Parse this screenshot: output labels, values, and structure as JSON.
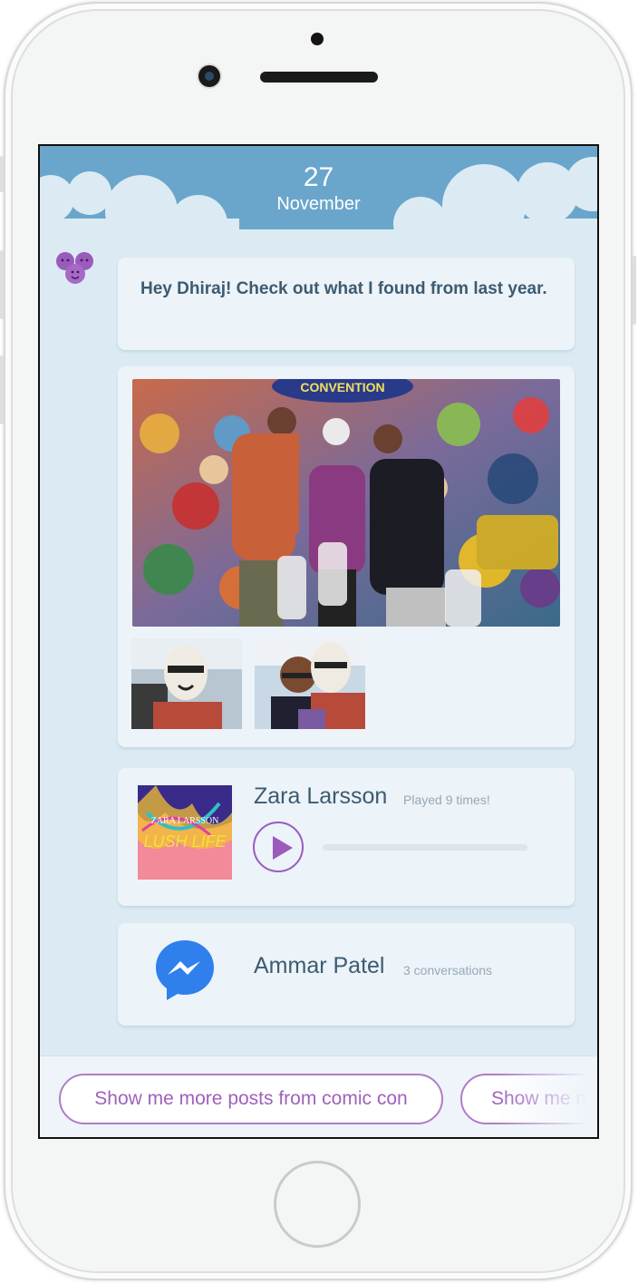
{
  "header": {
    "day": "27",
    "month": "November"
  },
  "colors": {
    "header_blue": "#6aa6cb",
    "background": "#dcebf3",
    "card": "#ecf3f9",
    "accent_purple": "#9a5bbd",
    "text_dark": "#3d5b70",
    "messenger_blue": "#2f80ed"
  },
  "bot": {
    "avatar_icon": "purple-faces-icon",
    "message": "Hey Dhiraj! Check out what I found from last year."
  },
  "photos": {
    "main_sign": "CONVENTION"
  },
  "music": {
    "album_title": "LUSH LIFE",
    "album_artist": "ZARA LARSSON",
    "artist": "Zara Larsson",
    "play_count": "Played 9 times!",
    "progress": 0
  },
  "chat": {
    "icon": "messenger-icon",
    "name": "Ammar Patel",
    "count": "3 conversations"
  },
  "suggestions": [
    {
      "label": "Show me more posts from comic con"
    },
    {
      "label": "Show me m"
    }
  ]
}
